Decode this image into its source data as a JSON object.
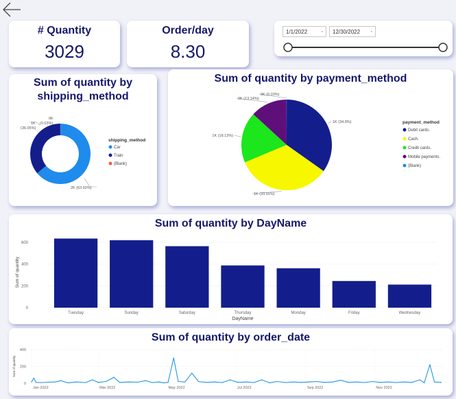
{
  "kpis": {
    "quantity_label": "# Quantity",
    "quantity_value": "3029",
    "order_label": "Order/day",
    "order_value": "8.30"
  },
  "date_slicer": {
    "start": "1/1/2022",
    "end": "12/30/2022"
  },
  "colors": {
    "navy": "#131e8c",
    "blue": "#1f8bec",
    "yellow": "#f7f700",
    "green": "#1ce61c",
    "purple": "#5e0f7a",
    "orange": "#e8643a",
    "line": "#2196e8"
  },
  "icons": {
    "back": "arrow-left-icon"
  },
  "chart_data": [
    {
      "type": "pie",
      "donut": true,
      "title": "Sum of quantity by shipping_method",
      "legend_title": "shipping_method",
      "legend_position": "right",
      "slices": [
        {
          "name": "Car",
          "value": 63.92,
          "label": "2K (63.92%)",
          "color": "#1f8bec"
        },
        {
          "name": "Train",
          "value": 36.05,
          "label": "1K (36.05%)",
          "color": "#131e8c"
        },
        {
          "name": "(Blank)",
          "value": 0.03,
          "label": "0K (0.03%)",
          "color": "#e8643a"
        }
      ]
    },
    {
      "type": "pie",
      "title": "Sum of quantity by payment_method",
      "legend_title": "payment_method",
      "legend_position": "right",
      "slices": [
        {
          "name": "Debit cards.",
          "value": 34.8,
          "label": "1K (34.8%)",
          "color": "#131e8c"
        },
        {
          "name": "Cash.",
          "value": 33.91,
          "label": "1K (33.91%)",
          "color": "#f7f700"
        },
        {
          "name": "Credit cards.",
          "value": 18.12,
          "label": "1K (18.12%)",
          "color": "#1ce61c"
        },
        {
          "name": "Mobile payments.",
          "value": 13.14,
          "label": "0K (13.14%)",
          "color": "#5e0f7a"
        },
        {
          "name": "(Blank)",
          "value": 0.03,
          "label": "0K (0.03%)",
          "color": "#1f8bec"
        }
      ]
    },
    {
      "type": "bar",
      "title": "Sum of quantity by DayName",
      "xlabel": "DayName",
      "ylabel": "Sum of quantity",
      "categories": [
        "Tuesday",
        "Sunday",
        "Saturday",
        "Thursday",
        "Monday",
        "Friday",
        "Wednesday"
      ],
      "values": [
        635,
        620,
        565,
        388,
        362,
        245,
        212
      ],
      "ylim": [
        0,
        650
      ],
      "yticks": [
        0,
        200,
        400,
        600
      ],
      "color": "#131e8c",
      "grid": true
    },
    {
      "type": "line",
      "title": "Sum of quantity by order_date",
      "ylabel": "Sum of quantity",
      "xticks": [
        "Jan 2022",
        "Mar 2022",
        "May 2022",
        "Jul 2022",
        "Sep 2022",
        "Nov 2022"
      ],
      "yticks": [
        0,
        200,
        400
      ],
      "ylim": [
        0,
        400
      ],
      "x_range": [
        "2022-01-01",
        "2022-12-31"
      ],
      "color": "#2196e8",
      "grid": true,
      "points": [
        [
          "2022-01-01",
          15
        ],
        [
          "2022-01-03",
          60
        ],
        [
          "2022-01-05",
          10
        ],
        [
          "2022-01-10",
          8
        ],
        [
          "2022-01-16",
          12
        ],
        [
          "2022-01-22",
          15
        ],
        [
          "2022-01-27",
          30
        ],
        [
          "2022-02-02",
          5
        ],
        [
          "2022-02-10",
          15
        ],
        [
          "2022-02-18",
          8
        ],
        [
          "2022-02-24",
          40
        ],
        [
          "2022-03-01",
          10
        ],
        [
          "2022-03-08",
          20
        ],
        [
          "2022-03-15",
          70
        ],
        [
          "2022-03-20",
          10
        ],
        [
          "2022-03-28",
          15
        ],
        [
          "2022-04-05",
          12
        ],
        [
          "2022-04-12",
          30
        ],
        [
          "2022-04-18",
          8
        ],
        [
          "2022-04-24",
          15
        ],
        [
          "2022-04-28",
          5
        ],
        [
          "2022-05-02",
          10
        ],
        [
          "2022-05-07",
          300
        ],
        [
          "2022-05-11",
          20
        ],
        [
          "2022-05-17",
          15
        ],
        [
          "2022-05-23",
          120
        ],
        [
          "2022-05-29",
          20
        ],
        [
          "2022-06-05",
          10
        ],
        [
          "2022-06-12",
          15
        ],
        [
          "2022-06-19",
          8
        ],
        [
          "2022-06-26",
          40
        ],
        [
          "2022-07-03",
          10
        ],
        [
          "2022-07-10",
          15
        ],
        [
          "2022-07-17",
          8
        ],
        [
          "2022-07-24",
          40
        ],
        [
          "2022-07-31",
          5
        ],
        [
          "2022-08-07",
          20
        ],
        [
          "2022-08-14",
          8
        ],
        [
          "2022-08-21",
          15
        ],
        [
          "2022-08-28",
          10
        ],
        [
          "2022-09-04",
          15
        ],
        [
          "2022-09-11",
          20
        ],
        [
          "2022-09-18",
          10
        ],
        [
          "2022-09-25",
          15
        ],
        [
          "2022-10-02",
          35
        ],
        [
          "2022-10-09",
          10
        ],
        [
          "2022-10-16",
          15
        ],
        [
          "2022-10-23",
          8
        ],
        [
          "2022-10-30",
          20
        ],
        [
          "2022-11-06",
          10
        ],
        [
          "2022-11-13",
          15
        ],
        [
          "2022-11-20",
          8
        ],
        [
          "2022-11-27",
          15
        ],
        [
          "2022-12-04",
          10
        ],
        [
          "2022-12-11",
          40
        ],
        [
          "2022-12-15",
          5
        ],
        [
          "2022-12-20",
          220
        ],
        [
          "2022-12-24",
          15
        ],
        [
          "2022-12-30",
          10
        ]
      ]
    }
  ]
}
